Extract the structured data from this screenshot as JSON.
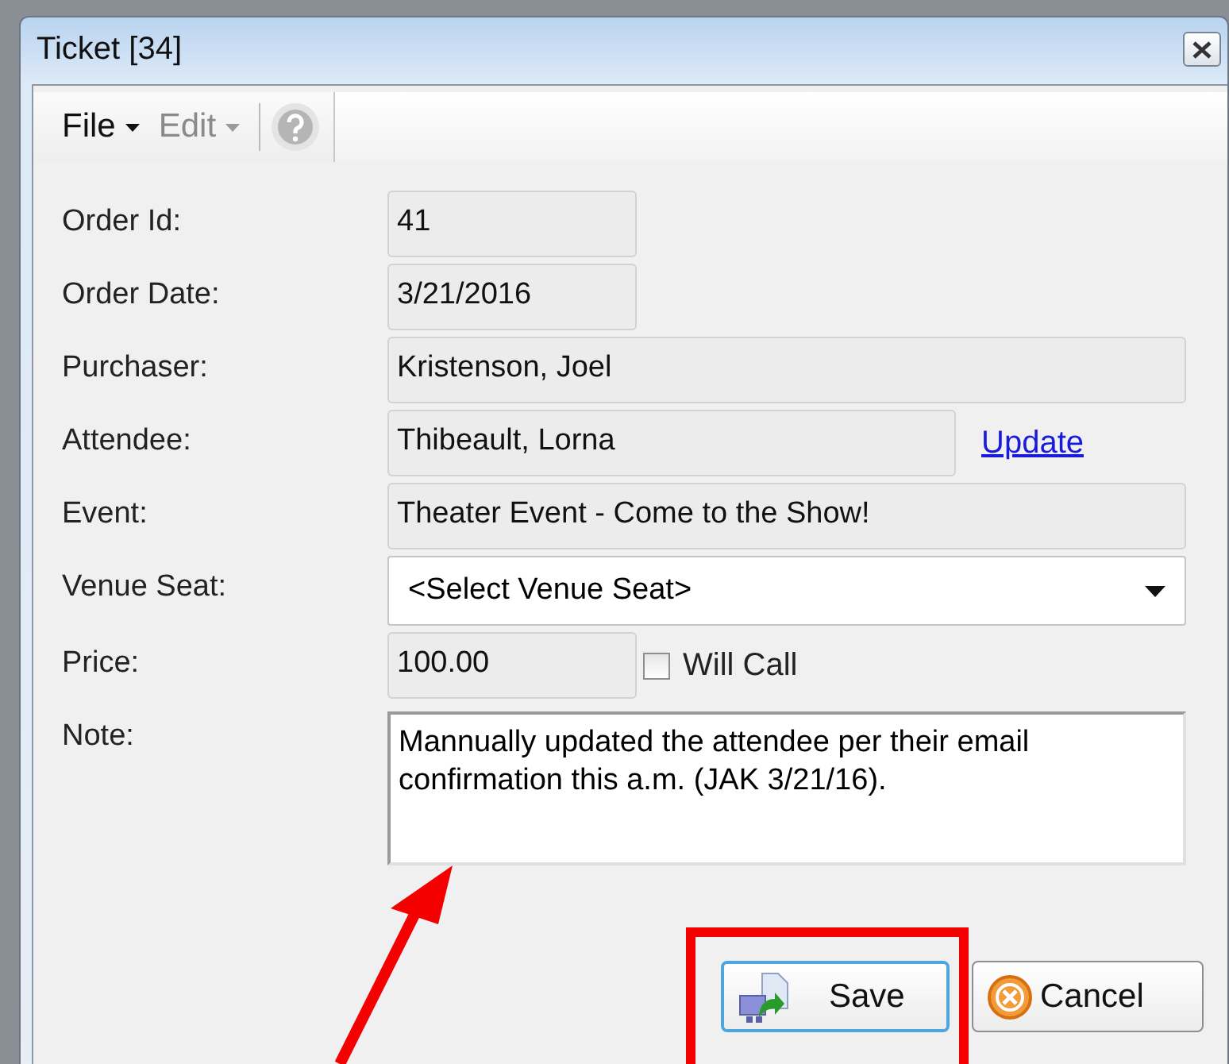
{
  "window": {
    "title": "Ticket [34]"
  },
  "menu": [
    {
      "label": "File",
      "disabled": false
    },
    {
      "label": "Edit",
      "disabled": true
    }
  ],
  "help_button": {
    "disabled": true
  },
  "fields": [
    {
      "kind": "short",
      "label": "Order Id:",
      "value": "41"
    },
    {
      "kind": "short",
      "label": "Order Date:",
      "value": "3/21/2016"
    },
    {
      "kind": "wide",
      "label": "Purchaser:",
      "value": "Kristenson, Joel"
    },
    {
      "kind": "linked",
      "label": "Attendee:",
      "value": "Thibeault, Lorna",
      "link": "Update"
    },
    {
      "kind": "wide",
      "label": "Event:",
      "value": "Theater Event - Come to the Show!"
    },
    {
      "kind": "select",
      "label": "Venue Seat:",
      "value": "<Select Venue Seat>"
    },
    {
      "kind": "check",
      "label": "Price:",
      "value": "100.00",
      "check_label": "Will Call",
      "checked": false
    },
    {
      "kind": "note",
      "label": "Note:",
      "value": "Mannually updated the attendee per their email confirmation this a.m. (JAK 3/21/16)."
    }
  ],
  "buttons": [
    {
      "kind": "save",
      "label": "Save",
      "focused": true
    },
    {
      "kind": "cancel",
      "label": "Cancel",
      "focused": false
    }
  ]
}
